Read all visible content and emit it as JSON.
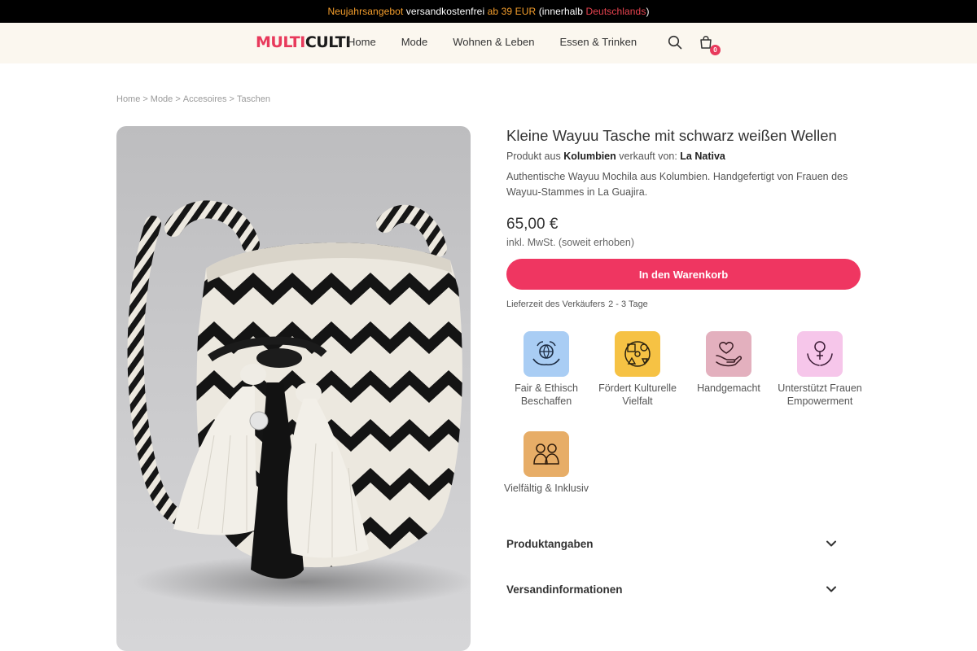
{
  "announcement": {
    "part1": "Neujahrsangebot",
    "part2": " versandkostenfrei ",
    "part3": "ab 39 EUR",
    "part4": " (innerhalb ",
    "part5": "Deutschlands",
    "part6": ")"
  },
  "header": {
    "logo_part1": "MULTI",
    "logo_part2": "CULTI",
    "nav": [
      "Home",
      "Mode",
      "Wohnen & Leben",
      "Essen & Trinken"
    ],
    "cart_count": "0"
  },
  "breadcrumb": [
    "Home",
    "Mode",
    "Accesoires",
    "Taschen"
  ],
  "product": {
    "title": "Kleine Wayuu Tasche mit schwarz weißen Wellen",
    "origin_prefix": "Produkt aus ",
    "origin_country": "Kolumbien",
    "origin_mid": " verkauft von: ",
    "seller": "La Nativa",
    "description": "Authentische Wayuu Mochila aus Kolumbien. Handgefertigt von Frauen des Wayuu-Stammes in La Guajira.",
    "price": "65,00 €",
    "vat_note": "inkl. MwSt. (soweit erhoben)",
    "cart_button": "In den Warenkorb",
    "delivery_label": "Lieferzeit des Verkäufers",
    "delivery_days": "2 - 3 Tage"
  },
  "badges": [
    {
      "label": "Fair & Ethisch Beschaffen",
      "icon": "globe-hands-icon",
      "color": "#a9cdf4"
    },
    {
      "label": "Fördert Kulturelle Vielfalt",
      "icon": "culture-shapes-icon",
      "color": "#f6c244"
    },
    {
      "label": "Handgemacht",
      "icon": "heart-hand-icon",
      "color": "#e3b0be"
    },
    {
      "label": "Unterstützt Frauen Empowerment",
      "icon": "female-symbol-hands-icon",
      "color": "#f6c6ea"
    },
    {
      "label": "Vielfältig & Inklusiv",
      "icon": "people-diversity-icon",
      "color": "#e7ad67"
    }
  ],
  "accordions": [
    "Produktangaben",
    "Versandinformationen"
  ],
  "colors": {
    "accent": "#ef3661",
    "header_bg": "#fbf7ef",
    "announcement_bg": "#000000"
  }
}
